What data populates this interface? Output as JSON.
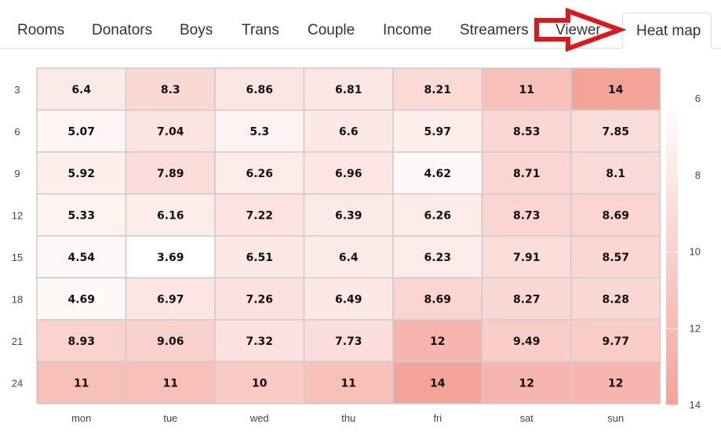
{
  "tabs": [
    {
      "label": "Rooms"
    },
    {
      "label": "Donators"
    },
    {
      "label": "Boys"
    },
    {
      "label": "Trans"
    },
    {
      "label": "Couple"
    },
    {
      "label": "Income"
    },
    {
      "label": "Streamers"
    },
    {
      "label": "Viewer"
    },
    {
      "label": "Heat map",
      "active": true
    }
  ],
  "annotation": {
    "type": "red-arrow",
    "color": "#e0161b",
    "points_to": "Heat map"
  },
  "chart_data": {
    "type": "heatmap",
    "x_categories": [
      "mon",
      "tue",
      "wed",
      "thu",
      "fri",
      "sat",
      "sun"
    ],
    "y_categories": [
      "3",
      "6",
      "9",
      "12",
      "15",
      "18",
      "21",
      "24"
    ],
    "values": [
      [
        "6.4",
        "8.3",
        "6.86",
        "6.81",
        "8.21",
        "11",
        "14"
      ],
      [
        "5.07",
        "7.04",
        "5.3",
        "6.6",
        "5.97",
        "8.53",
        "7.85"
      ],
      [
        "5.92",
        "7.89",
        "6.26",
        "6.96",
        "4.62",
        "8.71",
        "8.1"
      ],
      [
        "5.33",
        "6.16",
        "7.22",
        "6.39",
        "6.26",
        "8.73",
        "8.69"
      ],
      [
        "4.54",
        "3.69",
        "6.51",
        "6.4",
        "6.23",
        "7.91",
        "8.57"
      ],
      [
        "4.69",
        "6.97",
        "7.26",
        "6.49",
        "8.69",
        "8.27",
        "8.28"
      ],
      [
        "8.93",
        "9.06",
        "7.32",
        "7.73",
        "12",
        "9.49",
        "9.77"
      ],
      [
        "11",
        "11",
        "10",
        "11",
        "14",
        "12",
        "12"
      ]
    ],
    "color_scale": {
      "min_color": "#ffffff",
      "max_color": "#f4a399",
      "min": 3.69,
      "max": 14
    },
    "legend": {
      "position": "right",
      "ticks": [
        "6",
        "8",
        "10",
        "12",
        "14"
      ]
    },
    "grid": true
  }
}
